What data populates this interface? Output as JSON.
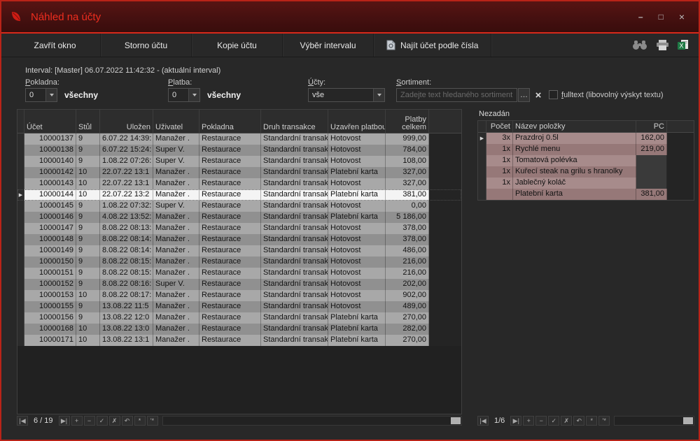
{
  "window": {
    "title": "Náhled na účty"
  },
  "toolbar": {
    "close_window": "Zavřít okno",
    "storno": "Storno účtu",
    "copy": "Kopie účtu",
    "interval": "Výběr intervalu",
    "find_by_number": "Najít účet podle čísla",
    "right_icons": [
      "binoculars-search",
      "print",
      "excel-export"
    ]
  },
  "interval_line": "Interval: [Master] 06.07.2022 11:42:32 - (aktuální interval)",
  "filters": {
    "pokladna": {
      "label": "Pokladna:",
      "value": "0",
      "suffix": "všechny"
    },
    "platba": {
      "label": "Platba:",
      "value": "0",
      "suffix": "všechny"
    },
    "ucty": {
      "label": "Účty:",
      "value": "vše"
    },
    "sortiment": {
      "label": "Sortiment:",
      "placeholder": "Zadejte text hledaného sortimentu",
      "ellipsis": "…"
    },
    "fulltext_label": "fulltext (libovolný výskyt textu)"
  },
  "accounts_grid": {
    "columns": [
      "Účet",
      "Stůl",
      "Uložen",
      "Uživatel",
      "Pokladna",
      "Druh transakce",
      "Uzavřen platbou",
      "Platby celkem"
    ],
    "selected_index": 5,
    "rows": [
      [
        "10000137",
        "9",
        "6.07.22 14:39:",
        "Manažer .",
        "Restaurace",
        "Standardní transakc",
        "Hotovost",
        "999,00"
      ],
      [
        "10000138",
        "9",
        "6.07.22 15:24:",
        "Super V.",
        "Restaurace",
        "Standardní transakc",
        "Hotovost",
        "784,00"
      ],
      [
        "10000140",
        "9",
        "1.08.22 07:26:",
        "Super V.",
        "Restaurace",
        "Standardní transakc",
        "Hotovost",
        "108,00"
      ],
      [
        "10000142",
        "10",
        "22.07.22 13:1",
        "Manažer .",
        "Restaurace",
        "Standardní transakc",
        "Platební karta",
        "327,00"
      ],
      [
        "10000143",
        "10",
        "22.07.22 13:1",
        "Manažer .",
        "Restaurace",
        "Standardní transakc",
        "Hotovost",
        "327,00"
      ],
      [
        "10000144",
        "10",
        "22.07.22 13:2",
        "Manažer .",
        "Restaurace",
        "Standardní transakc",
        "Platební karta",
        "381,00"
      ],
      [
        "10000145",
        "9",
        "1.08.22 07:32:",
        "Super V.",
        "Restaurace",
        "Standardní transakc",
        "Hotovost",
        "0,00"
      ],
      [
        "10000146",
        "9",
        "4.08.22 13:52:",
        "Manažer .",
        "Restaurace",
        "Standardní transakc",
        "Platební karta",
        "5 186,00"
      ],
      [
        "10000147",
        "9",
        "8.08.22 08:13:",
        "Manažer .",
        "Restaurace",
        "Standardní transakc",
        "Hotovost",
        "378,00"
      ],
      [
        "10000148",
        "9",
        "8.08.22 08:14:",
        "Manažer .",
        "Restaurace",
        "Standardní transakc",
        "Hotovost",
        "378,00"
      ],
      [
        "10000149",
        "9",
        "8.08.22 08:14:",
        "Manažer .",
        "Restaurace",
        "Standardní transakc",
        "Hotovost",
        "486,00"
      ],
      [
        "10000150",
        "9",
        "8.08.22 08:15:",
        "Manažer .",
        "Restaurace",
        "Standardní transakc",
        "Hotovost",
        "216,00"
      ],
      [
        "10000151",
        "9",
        "8.08.22 08:15:",
        "Manažer .",
        "Restaurace",
        "Standardní transakc",
        "Hotovost",
        "216,00"
      ],
      [
        "10000152",
        "9",
        "8.08.22 08:16:",
        "Super V.",
        "Restaurace",
        "Standardní transakc",
        "Hotovost",
        "202,00"
      ],
      [
        "10000153",
        "10",
        "8.08.22 08:17:",
        "Manažer .",
        "Restaurace",
        "Standardní transakc",
        "Hotovost",
        "902,00"
      ],
      [
        "10000155",
        "9",
        "13.08.22 11:5",
        "Manažer .",
        "Restaurace",
        "Standardní transakc",
        "Hotovost",
        "489,00"
      ],
      [
        "10000156",
        "9",
        "13.08.22 12:0",
        "Manažer .",
        "Restaurace",
        "Standardní transakc",
        "Platební karta",
        "270,00"
      ],
      [
        "10000168",
        "10",
        "13.08.22 13:0",
        "Manažer .",
        "Restaurace",
        "Standardní transakc",
        "Platební karta",
        "282,00"
      ],
      [
        "10000171",
        "10",
        "13.08.22 13:1",
        "Manažer .",
        "Restaurace",
        "Standardní transakc",
        "Platební karta",
        "270,00"
      ]
    ],
    "navigator": {
      "first": "|◀",
      "last": "▶|",
      "position": "6 / 19",
      "buttons": [
        {
          "name": "insert-record",
          "glyph": "+"
        },
        {
          "name": "delete-record",
          "glyph": "−"
        },
        {
          "name": "post-edit",
          "glyph": "✓"
        },
        {
          "name": "cancel-edit",
          "glyph": "✗"
        },
        {
          "name": "refresh",
          "glyph": "↶"
        },
        {
          "name": "save-bookmark",
          "glyph": "*"
        },
        {
          "name": "goto-bookmark",
          "glyph": "'*"
        }
      ]
    }
  },
  "items_panel": {
    "title": "Nezadán",
    "columns": [
      "Počet",
      "Název položky",
      "PC"
    ],
    "selected_index": 0,
    "rows": [
      [
        "3x",
        "Prazdroj 0.5l",
        "162,00"
      ],
      [
        "1x",
        "Rychlé menu",
        "219,00"
      ],
      [
        "1x",
        "Tomatová polévka",
        ""
      ],
      [
        "1x",
        "Kuřecí steak na grilu s hranolky",
        ""
      ],
      [
        "1x",
        "Jablečný koláč",
        ""
      ],
      [
        "",
        "Platební karta",
        "381,00"
      ]
    ],
    "navigator": {
      "first": "|◀",
      "last": "▶|",
      "position": "1/6",
      "buttons": [
        {
          "name": "insert-record",
          "glyph": "+"
        },
        {
          "name": "delete-record",
          "glyph": "−"
        },
        {
          "name": "post-edit",
          "glyph": "✓"
        },
        {
          "name": "cancel-edit",
          "glyph": "✗"
        },
        {
          "name": "refresh",
          "glyph": "↶"
        },
        {
          "name": "save-bookmark",
          "glyph": "*"
        },
        {
          "name": "goto-bookmark",
          "glyph": "'*"
        }
      ]
    }
  },
  "colors": {
    "accent_red": "#d8291a",
    "excel_green": "#1f7a45"
  }
}
